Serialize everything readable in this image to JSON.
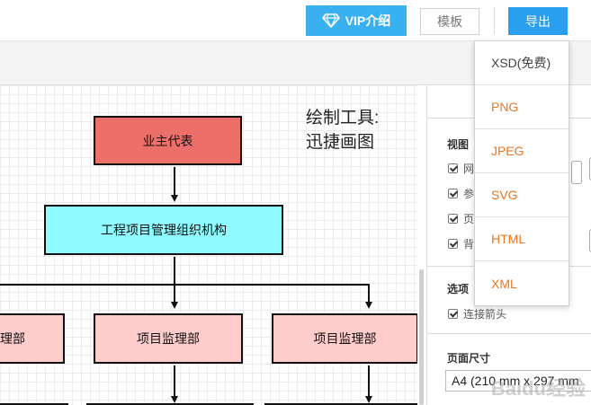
{
  "header": {
    "vip_label": "VIP介绍",
    "template_label": "模板",
    "export_label": "导出"
  },
  "export_menu": {
    "items": [
      {
        "label": "XSD(免费)",
        "color": "#444444"
      },
      {
        "label": "PNG",
        "color": "#e87722"
      },
      {
        "label": "JPEG",
        "color": "#e87722"
      },
      {
        "label": "SVG",
        "color": "#e87722"
      },
      {
        "label": "HTML",
        "color": "#e87722"
      },
      {
        "label": "XML",
        "color": "#e87722"
      }
    ]
  },
  "diagram": {
    "note_line1": "绘制工具:",
    "note_line2": "迅捷画图",
    "root": "业主代表",
    "org": "工程项目管理组织机构",
    "dept_left": "理部",
    "dept_mid": "项目监理部",
    "dept_right": "项目监理部",
    "colors": {
      "root_fill": "#ec6f69",
      "org_fill": "#8ffbff",
      "dept_fill": "#ffcccc",
      "bottom_fill": "#ccff99"
    }
  },
  "right_panel": {
    "view_title": "视图",
    "view_options": [
      "网",
      "参",
      "页",
      "背"
    ],
    "options_title": "选项",
    "connect_arrows": "连接箭头",
    "page_size_title": "页面尺寸",
    "page_size_value": "A4 (210 mm x 297 mm"
  },
  "watermark": "Baidu经验",
  "colors": {
    "vip_button": "#39b1f1",
    "export_button": "#2a9ff0",
    "menu_accent": "#e87722"
  }
}
